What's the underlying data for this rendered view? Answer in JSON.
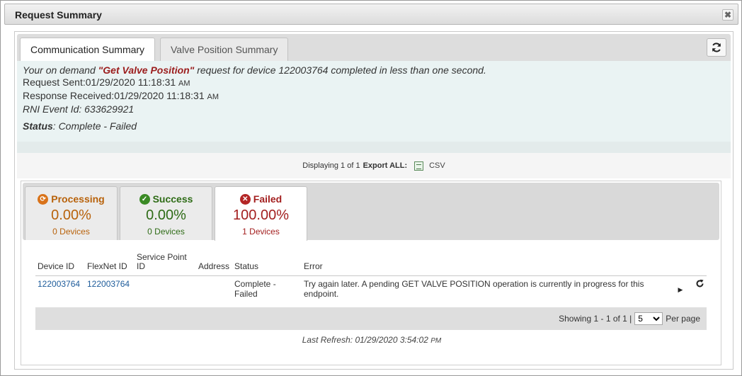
{
  "dialog": {
    "title": "Request Summary",
    "close_glyph": "✖"
  },
  "tabs": [
    {
      "label": "Communication Summary",
      "active": true
    },
    {
      "label": "Valve Position Summary",
      "active": false
    }
  ],
  "summary": {
    "intro_pre": "Your on demand ",
    "request_name": "\"Get Valve Position\"",
    "intro_post": " request for device 122003764 completed in less than one second.",
    "sent_label": "Request Sent:",
    "sent_value": "01/29/2020 11:18:31",
    "sent_ampm": "AM",
    "received_label": "Response Received:",
    "received_value": "01/29/2020 11:18:31",
    "received_ampm": "AM",
    "rni_event": "RNI Event Id: 633629921",
    "status_label": "Status",
    "status_value": ": Complete - Failed"
  },
  "export": {
    "displaying": "Displaying 1 of 1",
    "export_all": "Export ALL:",
    "csv": "CSV"
  },
  "status_tabs": [
    {
      "label": "Processing",
      "percent": "0.00%",
      "count": "0 Devices",
      "icon": "refresh-circle-icon",
      "color": "#b8620b"
    },
    {
      "label": "Success",
      "percent": "0.00%",
      "count": "0 Devices",
      "icon": "check-circle-icon",
      "color": "#2e6b16"
    },
    {
      "label": "Failed",
      "percent": "100.00%",
      "count": "1 Devices",
      "icon": "x-circle-icon",
      "color": "#a31f1f",
      "active": true
    }
  ],
  "table": {
    "headers": [
      "Device ID",
      "FlexNet ID",
      "Service Point ID",
      "Address",
      "Status",
      "Error"
    ],
    "rows": [
      {
        "device_id": "122003764",
        "flexnet_id": "122003764",
        "service_point_id": "",
        "address": "",
        "status": "Complete - Failed",
        "error": "Try again later. A pending GET VALVE POSITION operation is currently in progress for this endpoint."
      }
    ]
  },
  "pager": {
    "showing": "Showing 1 - 1 of 1 |",
    "per_page_value": "5",
    "per_page_label": "Per page"
  },
  "last_refresh": {
    "text": "Last Refresh: 01/29/2020 3:54:02",
    "ampm": "PM"
  }
}
